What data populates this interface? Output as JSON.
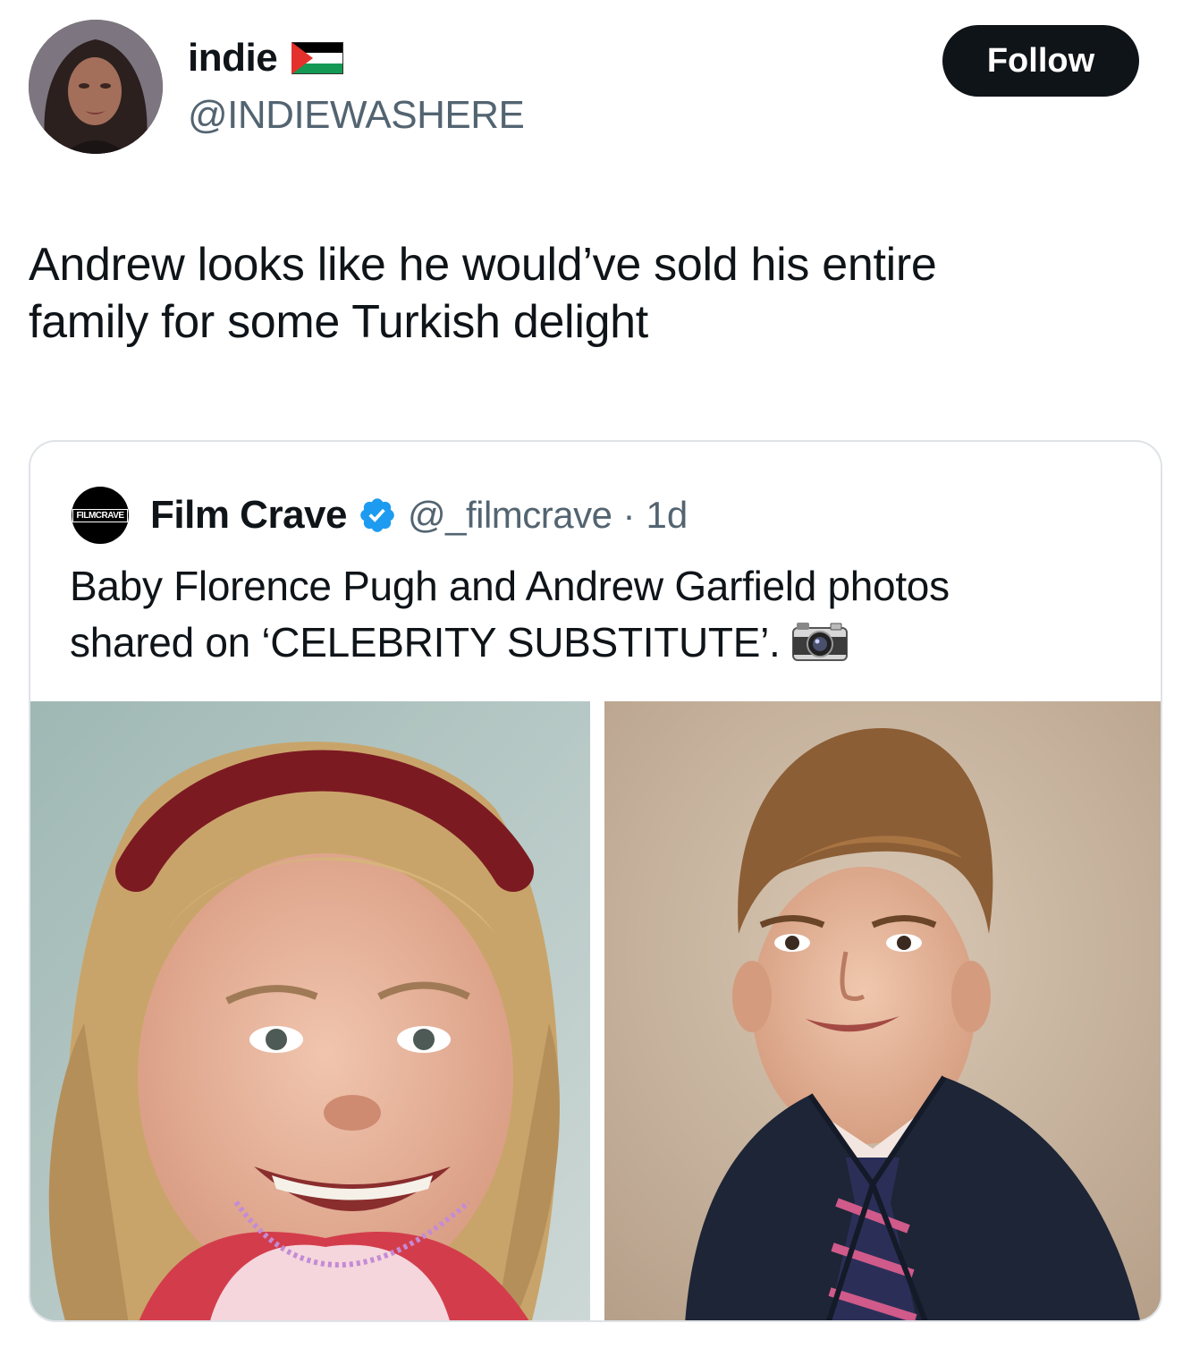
{
  "author": {
    "display_name": "indie",
    "flag_icon": "palestine-flag",
    "handle": "@INDIEWASHERE"
  },
  "follow_button": {
    "label": "Follow"
  },
  "tweet": {
    "text_line1": "Andrew looks like he would’ve sold his entire",
    "text_line2": "family for some Turkish delight"
  },
  "quoted_tweet": {
    "logo_text": "FILMCRAVE",
    "name": "Film Crave",
    "verified_icon": "verified-badge-icon",
    "handle": "@_filmcrave",
    "separator": "·",
    "time": "1d",
    "text_line1": "Baby Florence Pugh and Andrew Garfield photos",
    "text_line2": "shared on ‘CELEBRITY SUBSTITUTE’.",
    "emoji": "camera-with-flash-icon",
    "photos": [
      {
        "subject": "young girl with red headband smiling"
      },
      {
        "subject": "young boy in school blazer and striped tie"
      }
    ]
  },
  "colors": {
    "text": "#0f1419",
    "secondary_text": "#536471",
    "button_bg": "#0f1419",
    "verified": "#1d9bf0",
    "border": "#dfe3e6"
  }
}
